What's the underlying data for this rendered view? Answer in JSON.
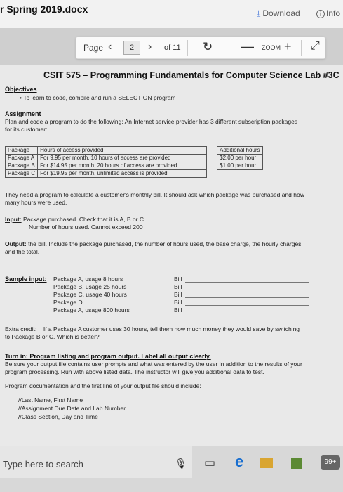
{
  "window": {
    "doc_title": "r Spring 2019.docx",
    "download_label": "Download",
    "info_label": "Info"
  },
  "toolbar": {
    "page_label": "Page",
    "current_page": "2",
    "of_pages": "of 11",
    "zoom_label": "ZOOM",
    "prev_icon": "‹",
    "next_icon": "›",
    "refresh_icon": "↻",
    "minus_icon": "—",
    "plus_icon": "+",
    "expand_icon": "⤢"
  },
  "doc": {
    "heading": "CSIT 575 – Programming Fundamentals for Computer Science Lab #3C",
    "objectives_head": "Objectives",
    "objective_1": "To learn to code, compile and run a SELECTION program",
    "assignment_head": "Assignment",
    "assignment_1": "Plan and code a program to do the following: An Internet service provider has 3 different subscription packages",
    "assignment_2": "for its customer:",
    "table": {
      "rows": [
        [
          "Package",
          "Hours of access provided"
        ],
        [
          "Package A",
          "For 9.95 per month, 10 hours of access are provided"
        ],
        [
          "Package B",
          "For $14.95 per month, 20 hours of access are provided"
        ],
        [
          "Package C",
          "For $19.95 per month, unlimited access is provided"
        ]
      ],
      "extra_head": "Additional hours",
      "extra_rows": [
        "$2.00 per hour",
        "$1.00 per hour"
      ]
    },
    "need_1": "They need a program to calculate a customer's monthly bill. It should ask which package was purchased and how",
    "need_2": "many hours were used.",
    "input_head": "Input:",
    "input_1": "Package purchased. Check that it is A, B or C",
    "input_2": "Number of hours used. Cannot exceed 200",
    "output_head": "Output:",
    "output_1": "the bill. Include the package purchased, the number of hours used, the base charge, the hourly charges",
    "output_2": "and the total.",
    "sample_head": "Sample input:",
    "samples": [
      "Package A, usage 8 hours",
      "Package B, usage 25 hours",
      "Package C, usage 40 hours",
      "Package D",
      "Package A, usage 800 hours"
    ],
    "bill_label": "Bill",
    "extra_credit_label": "Extra credit:",
    "extra_credit_1": "If a Package A customer uses 30 hours, tell them how much money they would save by switching",
    "extra_credit_2": "to Package B or C. Which is better?",
    "turnin_head": "Turn in: Program listing and program output. Label all output clearly.",
    "turnin_1": "Be sure your output file contains user prompts and what was entered by the user in addition to the results of your",
    "turnin_2": "program processing. Run with above listed data. The instructor will give you additional data to test.",
    "doc_req": "Program documentation and the first line of your output file should include:",
    "comment_1": "//Last Name, First Name",
    "comment_2": "//Assignment Due Date and Lab Number",
    "comment_3": "//Class Section, Day and Time"
  },
  "taskbar": {
    "search_placeholder": "Type here to search",
    "badge": "99+"
  }
}
